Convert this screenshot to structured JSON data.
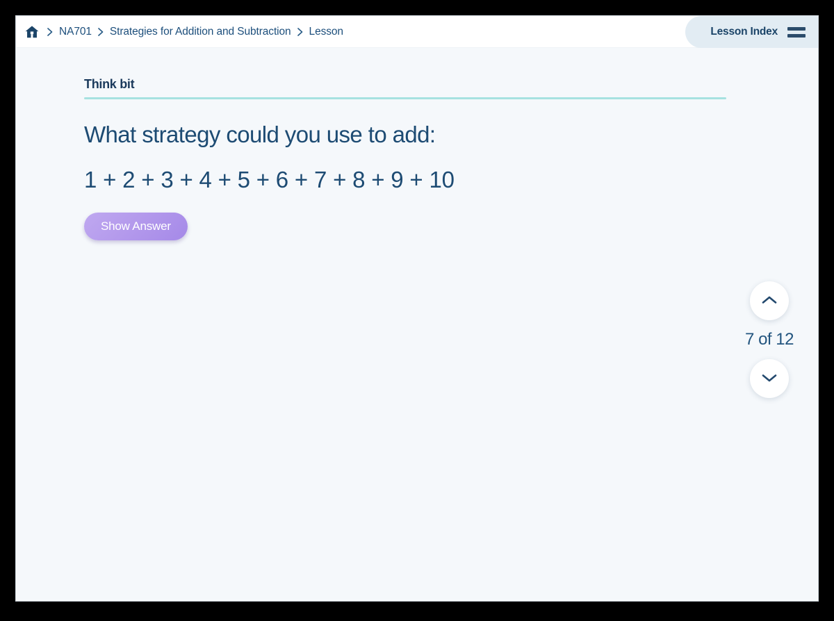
{
  "header": {
    "home_icon": "home-icon",
    "breadcrumb": [
      {
        "label": "NA701"
      },
      {
        "label": "Strategies for Addition and Subtraction"
      },
      {
        "label": "Lesson"
      }
    ],
    "separator": "›",
    "lesson_index_label": "Lesson Index",
    "menu_icon": "hamburger-icon",
    "pill_bg": "#e2ecf3"
  },
  "lesson": {
    "section_title": "Think bit",
    "rule_color": "#a6e2e0",
    "question": "What strategy could you use to add:",
    "expression": "1 + 2 + 3 + 4 + 5 + 6 + 7 + 8 + 9 + 10",
    "show_answer_label": "Show Answer",
    "button_gradient_from": "#bfa8f0",
    "button_gradient_to": "#a589e8",
    "text_color": "#1d4b73"
  },
  "pager": {
    "previous_icon": "chevron-up-icon",
    "next_icon": "chevron-down-icon",
    "counter": "7 of 12",
    "current_page": 7,
    "total_pages": 12
  },
  "theme": {
    "content_bg": "#f5f8fb",
    "header_bg": "#ffffff",
    "frame_bg": "#000000"
  }
}
